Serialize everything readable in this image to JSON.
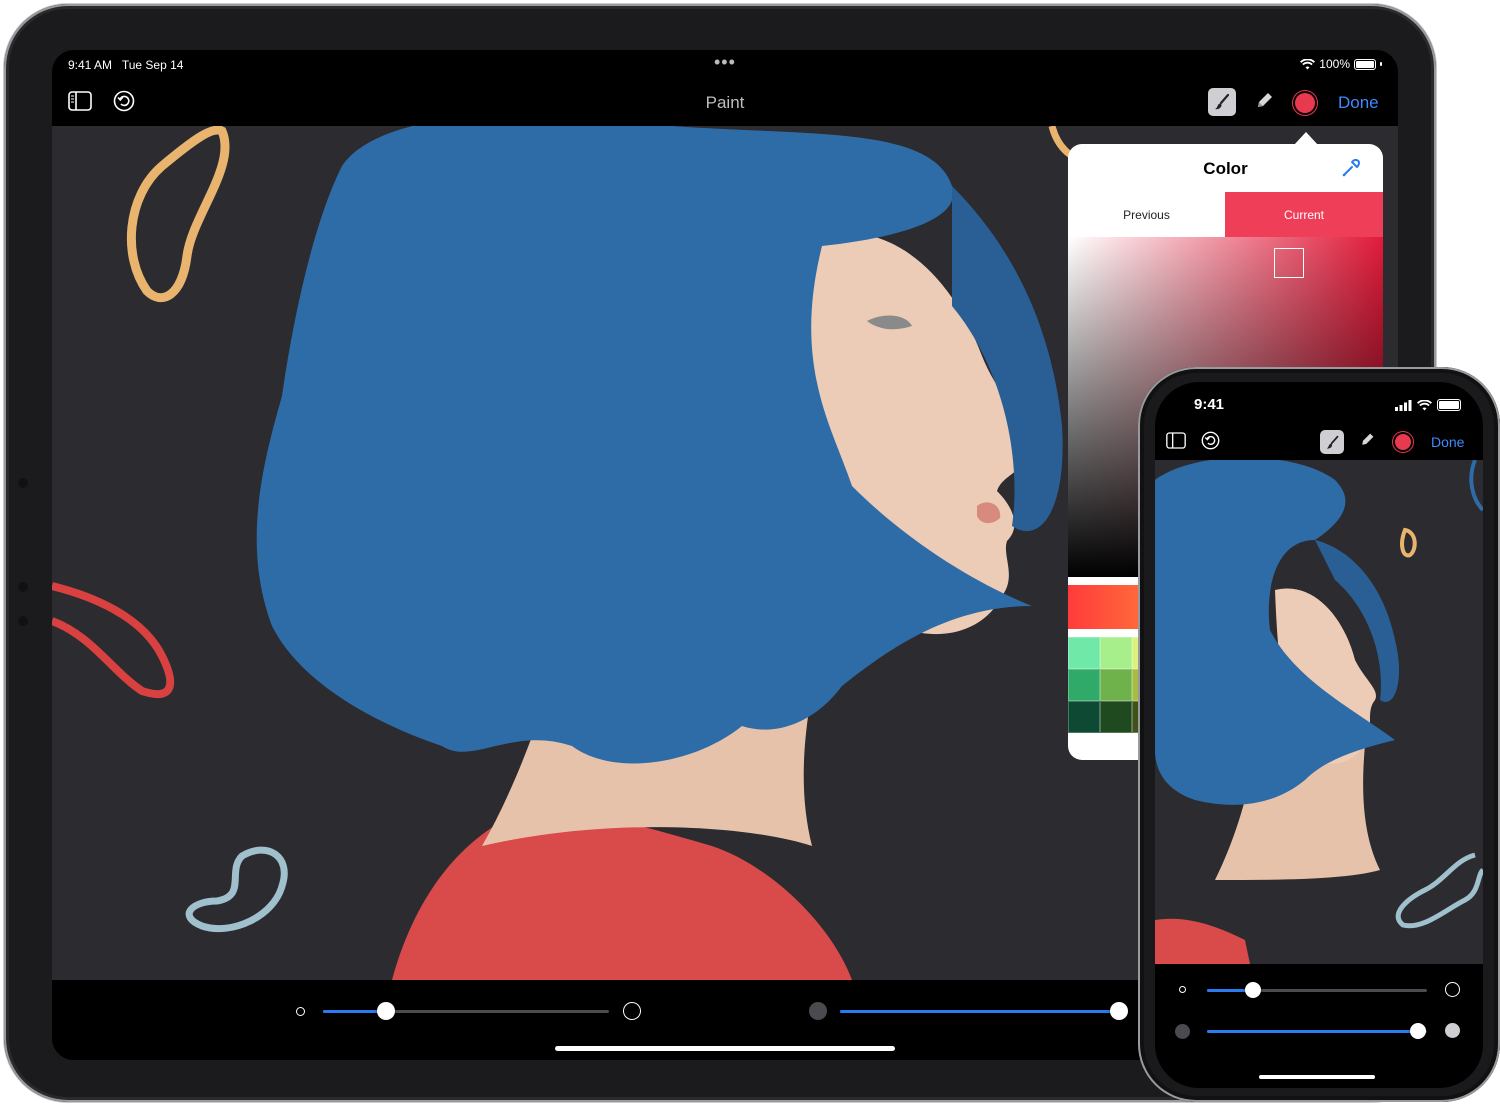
{
  "ipad": {
    "status": {
      "time": "9:41 AM",
      "date": "Tue Sep 14",
      "battery": "100%",
      "multitask": "•••"
    },
    "toolbar": {
      "title": "Paint",
      "done_label": "Done"
    },
    "sliders": {
      "brush_size_level": 0.22,
      "opacity_level": 0.97
    }
  },
  "color_popover": {
    "title": "Color",
    "tab_previous": "Previous",
    "tab_current": "Current",
    "current_color": "#ef3f58",
    "swatch_colors": [
      "#6fe8a8",
      "#a7ef8a",
      "#d9f37d",
      "#f8f48a",
      "#f6d57a",
      "#f3b07a",
      "#f08a86",
      "#ee86b6",
      "#c88ce8",
      "#8ca5ef",
      "#2faa69",
      "#6fb24c",
      "#a6bd43",
      "#d1cb49",
      "#d9a04a",
      "#d57a4a",
      "#cd4f57",
      "#c74a8a",
      "#9a4cc0",
      "#4e66c7",
      "#0e4a33",
      "#1f4a1f",
      "#3f5219",
      "#5a5a1c",
      "#6a4d1c",
      "#6a341c",
      "#651e22",
      "#5f1c44",
      "#4a1c5e",
      "#1c2a5e"
    ]
  },
  "iphone": {
    "status": {
      "time": "9:41"
    },
    "toolbar": {
      "done_label": "Done"
    },
    "sliders": {
      "brush_size_level": 0.21,
      "opacity_level": 0.96
    }
  },
  "icons": [
    "sidebar-icon",
    "undo-icon",
    "brush-tool-icon",
    "pencil-tool-icon",
    "color-swatch-icon",
    "eyedropper-icon",
    "wifi-icon",
    "battery-icon",
    "cellular-icon"
  ],
  "colors": {
    "accent": "#3d8bff",
    "selected": "#ef3f58",
    "canvas": "#2b2b30"
  }
}
